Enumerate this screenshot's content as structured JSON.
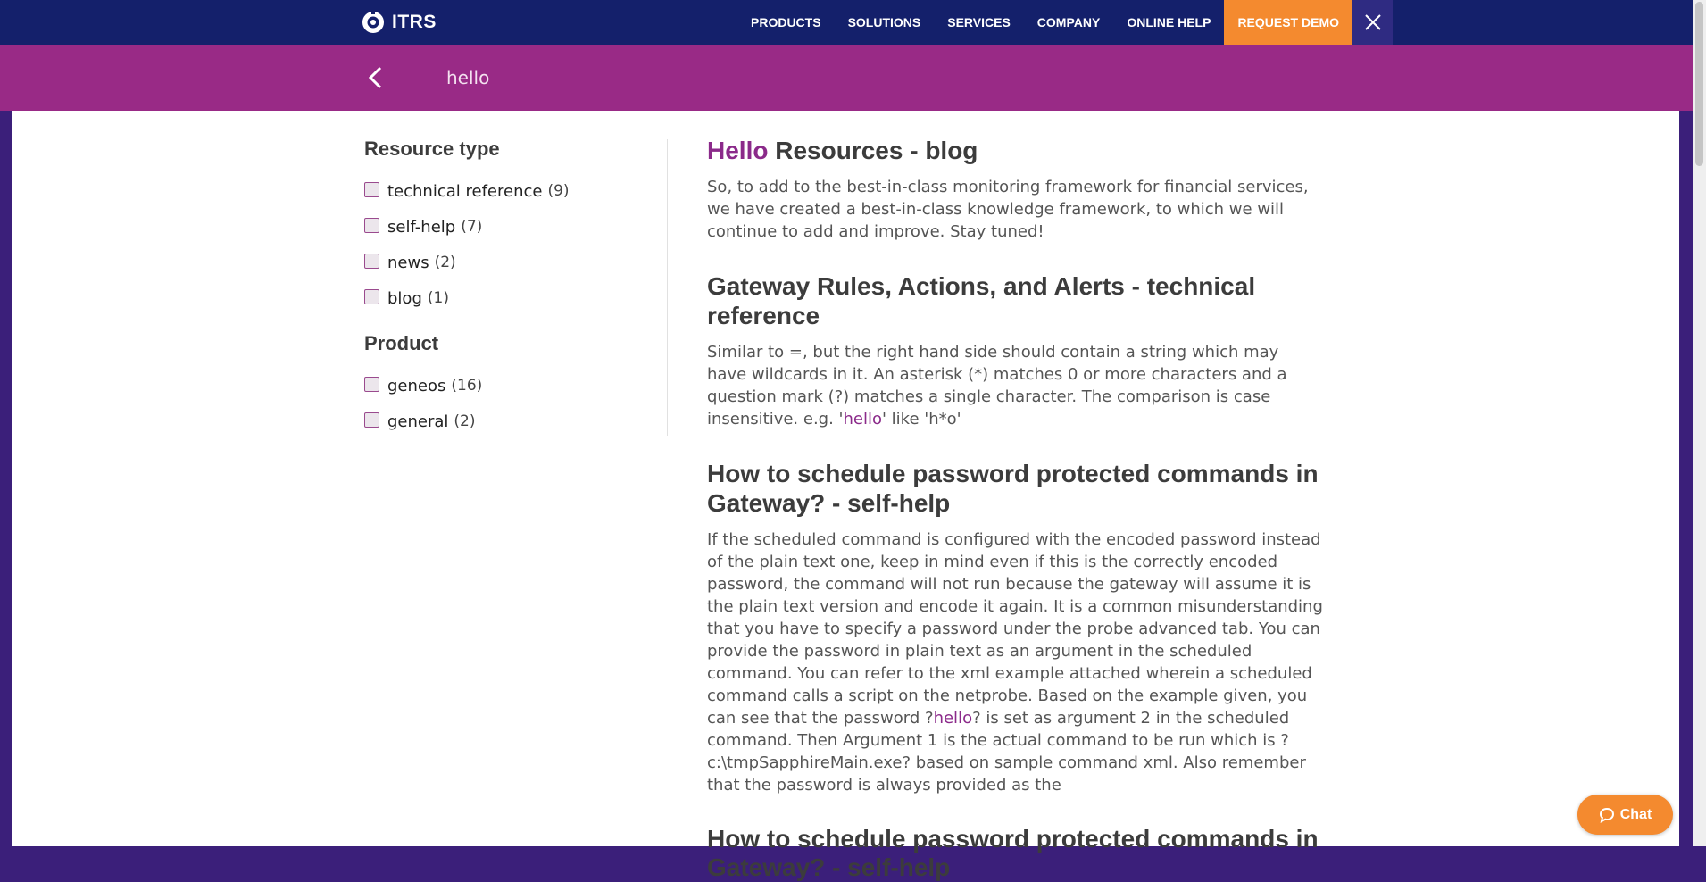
{
  "nav": {
    "logo_text": "ITRS",
    "items": [
      "PRODUCTS",
      "SOLUTIONS",
      "SERVICES",
      "COMPANY",
      "ONLINE HELP"
    ],
    "demo_label": "REQUEST DEMO"
  },
  "search": {
    "query": "hello"
  },
  "filters": {
    "resource_heading": "Resource type",
    "resource_types": [
      {
        "label": "technical reference",
        "count": "(9)"
      },
      {
        "label": "self-help",
        "count": "(7)"
      },
      {
        "label": "news",
        "count": "(2)"
      },
      {
        "label": "blog",
        "count": "(1)"
      }
    ],
    "product_heading": "Product",
    "products": [
      {
        "label": "geneos",
        "count": "(16)"
      },
      {
        "label": "general",
        "count": "(2)"
      }
    ]
  },
  "results": [
    {
      "title_hl": "Hello",
      "title_rest": " Resources - blog",
      "body": "So, to add to the best-in-class monitoring framework for financial services, we have created a best-in-class knowledge framework, to which we will continue to add and improve. Stay tuned!"
    },
    {
      "title": "Gateway Rules, Actions, and Alerts - technical reference",
      "body_pre": "Similar to =, but the right hand side should contain a string which may have wildcards in it. An asterisk (*) matches 0 or more characters and a question mark (?) matches a single character. The comparison is case insensitive. e.g. '",
      "body_hl": "hello",
      "body_post": "' like 'h*o'"
    },
    {
      "title": "How to schedule password protected commands in Gateway? - self-help",
      "body_pre": "If the scheduled command is configured with the encoded password instead of the plain text one, keep in mind even if this is the correctly encoded password, the command will not run because the gateway will assume it is the plain text version and encode it again. It is a common misunderstanding that you have to specify a password under the probe advanced tab. You can provide the password in plain text as an argument in the scheduled command. You can refer to the xml example attached wherein a scheduled command calls a script on the netprobe. Based on the example given, you can see that the password ?",
      "body_hl": "hello",
      "body_post": "? is set as argument 2 in the scheduled command. Then Argument 1 is the actual command to be run which is ?c:\\tmpSapphireMain.exe? based on sample command xml. Also remember that the password is always provided as the"
    }
  ],
  "partial_title": "How to schedule password protected commands in Gateway? - self-help",
  "chat": {
    "label": "Chat"
  },
  "colors": {
    "nav_bg": "#14206b",
    "search_bg": "#992a86",
    "accent_orange": "#f48a2f",
    "highlight": "#8b2a8a",
    "side_bg": "#3b1f7a"
  },
  "icons": {
    "logo": "itrs-logo-icon",
    "close": "close-icon",
    "back": "chevron-left-icon",
    "chat": "chat-bubble-icon"
  }
}
